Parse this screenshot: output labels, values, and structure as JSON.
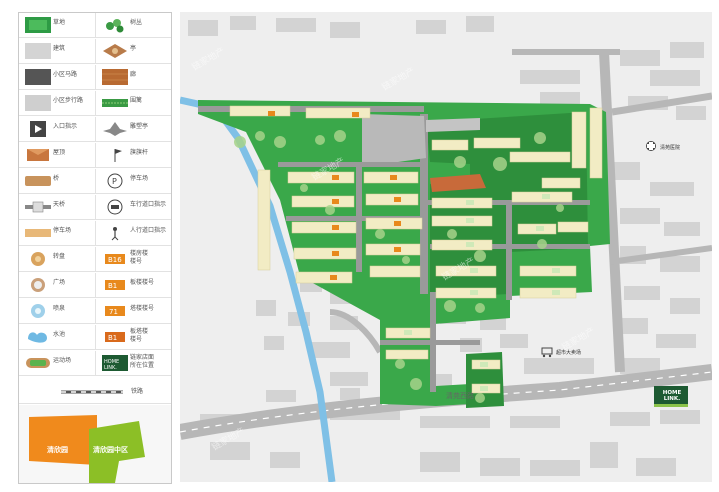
{
  "legend": {
    "rows": [
      [
        {
          "icon": "grass-swatch",
          "label": "草地"
        },
        {
          "icon": "shrub-icon",
          "label": "树丛"
        }
      ],
      [
        {
          "icon": "building-swatch",
          "label": "建筑"
        },
        {
          "icon": "pavilion-icon",
          "label": "亭"
        }
      ],
      [
        {
          "icon": "main-road-swatch",
          "label": "小区马路"
        },
        {
          "icon": "wood-deck-swatch",
          "label": "廊"
        }
      ],
      [
        {
          "icon": "paved-road-swatch",
          "label": "小区步行路"
        },
        {
          "icon": "hedge-swatch",
          "label": "围篱"
        }
      ],
      [
        {
          "icon": "entrance-icon",
          "label": "入口指示"
        },
        {
          "icon": "sculpture-icon",
          "label": "雕塑亭"
        }
      ],
      [
        {
          "icon": "roof-icon",
          "label": "屋顶"
        },
        {
          "icon": "flagpole-icon",
          "label": "旗旗杆"
        }
      ],
      [
        {
          "icon": "bridge-swatch",
          "label": "桥"
        },
        {
          "icon": "parking-icon",
          "label": "停车场"
        }
      ],
      [
        {
          "icon": "overpass-icon",
          "label": "天桥"
        },
        {
          "icon": "vehicle-gate-icon",
          "label": "车行道口指示"
        }
      ],
      [
        {
          "icon": "parking-lot-swatch",
          "label": "停车场"
        },
        {
          "icon": "pedestrian-gate-icon",
          "label": "人行道口指示"
        }
      ],
      [
        {
          "icon": "plaza-circle-icon",
          "label": "转盘"
        },
        {
          "icon": "building-tag-orange-icon",
          "label": "楼房楼\n楼号"
        }
      ],
      [
        {
          "icon": "square-circle-icon",
          "label": "广场"
        },
        {
          "icon": "tag-b1-icon",
          "label": "板楼楼号"
        }
      ],
      [
        {
          "icon": "fountain-icon",
          "label": "喷泉"
        },
        {
          "icon": "tag-71-icon",
          "label": "塔楼楼号"
        }
      ],
      [
        {
          "icon": "water-icon",
          "label": "水池"
        },
        {
          "icon": "tag-b1b-icon",
          "label": "板塔楼\n楼号"
        }
      ],
      [
        {
          "icon": "sports-field-icon",
          "label": "运动场"
        },
        {
          "icon": "homelink-icon",
          "label": "链家店面\n所在位置"
        }
      ]
    ],
    "railway_label": "铁路",
    "inset": {
      "left_label": "清欣园",
      "right_label": "清欣园中区"
    }
  },
  "map": {
    "labels": {
      "hospital": "清苑医院",
      "road_south": "清苑西路",
      "supermarket": "超市大卖场"
    },
    "homelink_label": "HOME LINK.",
    "watermark": "链家地产"
  }
}
